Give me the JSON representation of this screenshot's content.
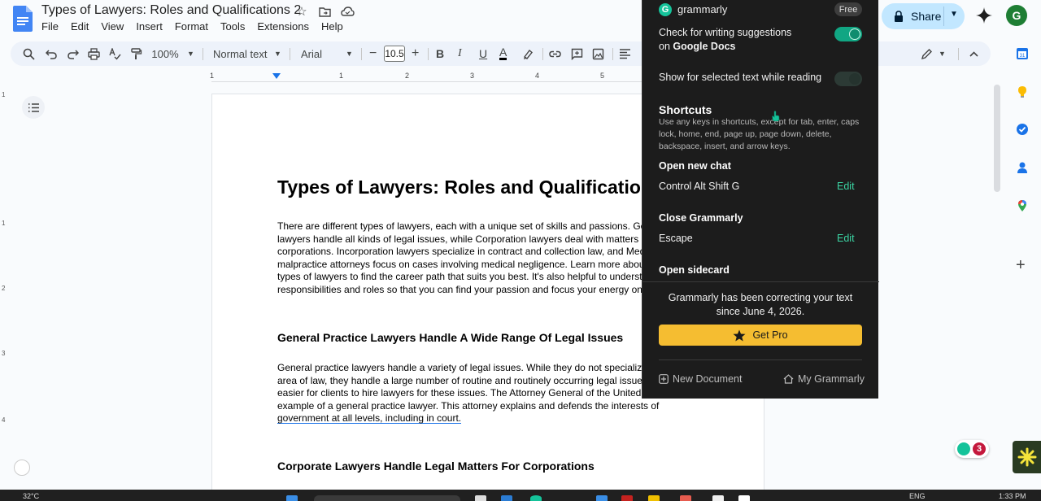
{
  "doc": {
    "title": "Types of Lawyers: Roles and Qualifications 2",
    "menu": [
      "File",
      "Edit",
      "View",
      "Insert",
      "Format",
      "Tools",
      "Extensions",
      "Help"
    ],
    "share_label": "Share",
    "avatar_letter": "G"
  },
  "toolbar": {
    "zoom": "100%",
    "style": "Normal text",
    "font": "Arial",
    "font_size": "10.5"
  },
  "ruler": {
    "ticks": [
      "1",
      "1",
      "2",
      "3",
      "4",
      "5"
    ],
    "vticks": [
      "1",
      "1",
      "2",
      "3",
      "4"
    ]
  },
  "content": {
    "heading": "Types of Lawyers: Roles and Qualifications",
    "para1": [
      "There are different types of lawyers, each with a unique set of skills and passions. General",
      "lawyers handle all kinds of legal issues, while Corporation lawyers deal with matters rela",
      "corporations. Incorporation lawyers specialize in contract and collection law, and Medica",
      "malpractice attorneys focus on cases involving medical negligence. Learn more about t",
      "types of lawyers to find the career path that suits you best. It's also helpful to understan",
      "responsibilities and roles so that you can find your passion and focus your energy on it."
    ],
    "subheading1": "General Practice Lawyers Handle A Wide Range Of Legal Issues",
    "para2": [
      "General practice lawyers handle a variety of legal issues. While they do not specialize i",
      "area of law, they handle a large number of routine and routinely occurring legal issues.",
      "easier for clients to hire lawyers for these issues. The Attorney General of the United S",
      "example of a general practice lawyer. This attorney explains and defends the interests of the",
      "government at all levels, including in court."
    ],
    "subheading2": "Corporate Lawyers Handle Legal Matters For Corporations"
  },
  "grammarly": {
    "brand": "grammarly",
    "plan_badge": "Free",
    "setting1_line1": "Check for writing suggestions",
    "setting1_line2_prefix": "on ",
    "setting1_line2_bold": "Google Docs",
    "setting1_on": true,
    "setting2": "Show for selected text while reading",
    "setting2_on": false,
    "shortcuts_title": "Shortcuts",
    "shortcuts_desc": "Use any keys in shortcuts, except for tab, enter, caps lock, home, end, page up, page down, delete, backspace, insert, and arrow keys.",
    "shortcut1_name": "Open new chat",
    "shortcut1_keys": "Control Alt Shift G",
    "shortcut2_name": "Close Grammarly",
    "shortcut2_keys": "Escape",
    "shortcut3_name": "Open sidecard",
    "edit_label": "Edit",
    "correcting_line1": "Grammarly has been correcting your text",
    "correcting_line2": "since June 4, 2026.",
    "pro_label": "Get Pro",
    "new_doc_label": "New Document",
    "my_grammarly_label": "My Grammarly",
    "badge_count": "3",
    "accent": "#15c39a",
    "pro_color": "#f5bd31"
  },
  "taskbar": {
    "weather": "32°C",
    "lang": "ENG",
    "time": "1:33 PM"
  }
}
